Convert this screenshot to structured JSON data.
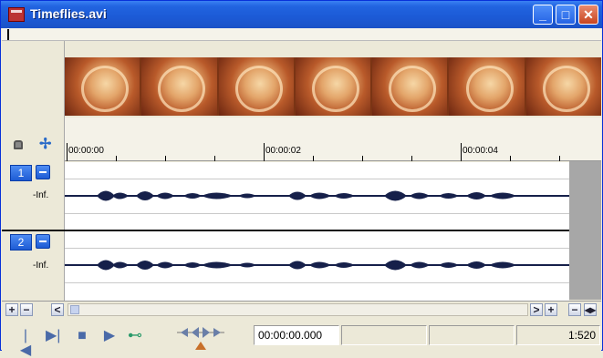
{
  "window": {
    "title": "Timeflies.avi",
    "minimize": "_",
    "maximize": "□",
    "close": "✕"
  },
  "ruler": {
    "t0": "00:00:00",
    "t1": "00:00:02",
    "t2": "00:00:04"
  },
  "tracks": [
    {
      "number": "1",
      "level": "-Inf."
    },
    {
      "number": "2",
      "level": "-Inf."
    }
  ],
  "scroll": {
    "plus": "+",
    "minus": "−",
    "left": "<",
    "right": ">",
    "zoom_in": "+",
    "zoom_out": "−",
    "lr": "◂▸"
  },
  "transport": {
    "go_start": "|◀",
    "go_end": "▶|",
    "stop": "■",
    "play": "▶",
    "loop": "⊷",
    "time": "00:00:00.000",
    "zoom_ratio": "1:520"
  },
  "colors": {
    "title_bar": "#2164e0",
    "waveform": "#16204a",
    "film": "#b95a2a"
  }
}
